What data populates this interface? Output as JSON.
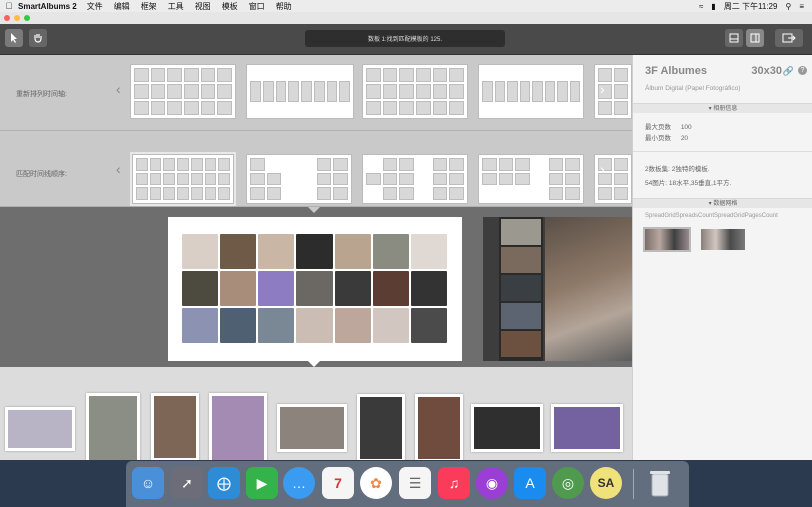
{
  "menubar": {
    "app_name": "SmartAlbums 2",
    "items": [
      "文件",
      "编辑",
      "框架",
      "工具",
      "视图",
      "模板",
      "窗口",
      "帮助"
    ],
    "clock": "周二 下午11:29"
  },
  "toolbar": {
    "status_text": "数板 1:找到匹配模板的 125."
  },
  "templates": {
    "row1_label": "重新排列时间轴:",
    "row2_label": "匹配时间线顺序:"
  },
  "inspector": {
    "title": "3F Albumes",
    "size": "30x30",
    "subtitle": "Álbum Digital (Papel Fotográfico)",
    "section1": "相册信息",
    "max_pages_label": "最大页数",
    "max_pages": "100",
    "min_pages_label": "最小页数",
    "min_pages": "20",
    "info_line1": "2数板集: 2独特的模板.",
    "info_line2": "54图片: 18水平,35垂直,1平方.",
    "section2": "数据网格",
    "grid_id": "SpreadGridSpreadsCountSpreadGridPagesCount"
  },
  "colors": {
    "accent_blue": "#2d6fd6",
    "app_bg": "#6b6b6b",
    "template_bg": "#c9c9c9",
    "inspector_bg": "#f4f4f4"
  }
}
